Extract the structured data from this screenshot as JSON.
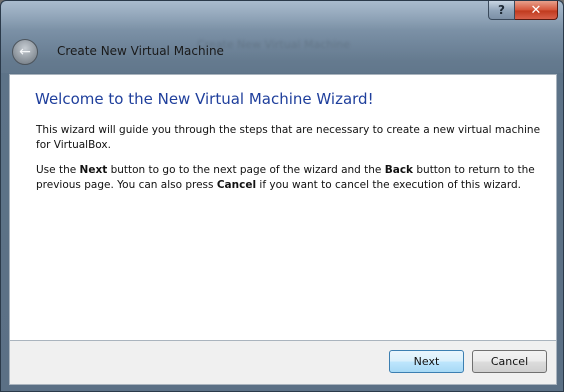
{
  "window": {
    "title": "Create New Virtual Machine",
    "ghost_title": "Create New Virtual Machine",
    "help_glyph": "?",
    "close_glyph": "✕",
    "back_glyph": "←"
  },
  "content": {
    "heading": "Welcome to the New Virtual Machine Wizard!",
    "paragraph1": "This wizard will guide you through the steps that are necessary to create a new virtual machine for VirtualBox.",
    "paragraph2": {
      "t1": "Use the ",
      "b1": "Next",
      "t2": " button to go to the next page of the wizard and the ",
      "b2": "Back",
      "t3": " button to return to the previous page. You can also press ",
      "b3": "Cancel",
      "t4": " if you want to cancel the execution of this wizard."
    }
  },
  "buttons": {
    "next": "Next",
    "cancel": "Cancel"
  },
  "icons": {
    "back": "back-arrow-icon",
    "help": "help-icon",
    "close": "close-icon"
  }
}
